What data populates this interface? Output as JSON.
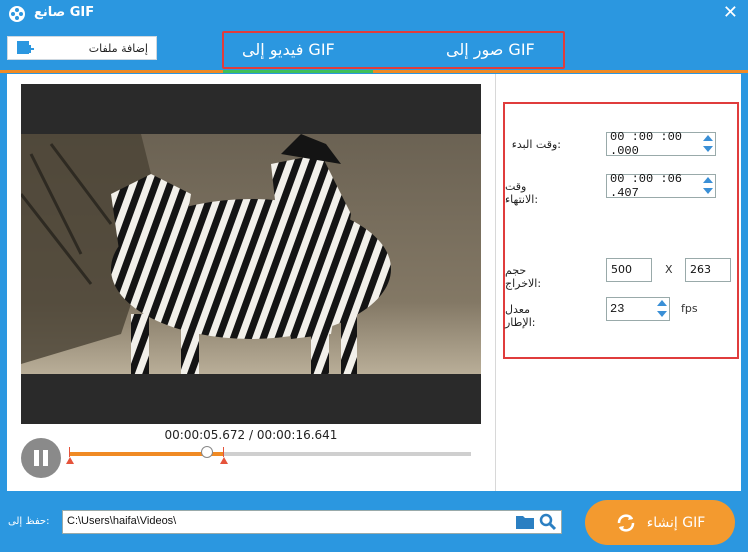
{
  "window": {
    "title": "صانع GIF"
  },
  "toolbar": {
    "add_files_label": "إضافة ملفات"
  },
  "tabs": {
    "video_to_gif": "فيديو إلى GIF",
    "images_to_gif": "صور إلى GIF",
    "active": "video_to_gif"
  },
  "player": {
    "current_time": "00:00:05.672",
    "total_time": "00:00:16.641",
    "time_separator": " / ",
    "progress": 0.341
  },
  "settings": {
    "start_time_label": "وقت البدء:",
    "start_time_value": "00 :00 :00 .000",
    "end_time_label": "وقت الانتهاء:",
    "end_time_value": "00 :00 :06 .407",
    "output_size_label": "حجم الاخراج:",
    "width": "500",
    "x_label": "X",
    "height": "263",
    "frame_rate_label": "معدل الإطار:",
    "frame_rate": "23",
    "fps_label": "fps"
  },
  "bottom": {
    "save_to_label": "حفظ إلى:",
    "path": "C:\\Users\\haifa\\Videos\\",
    "create_gif_label": "إنشاء GIF"
  },
  "colors": {
    "accent": "#2b97e0",
    "orange": "#f08a24",
    "highlight_box": "#e03c3c",
    "tab_active": "#3fbf5a"
  }
}
